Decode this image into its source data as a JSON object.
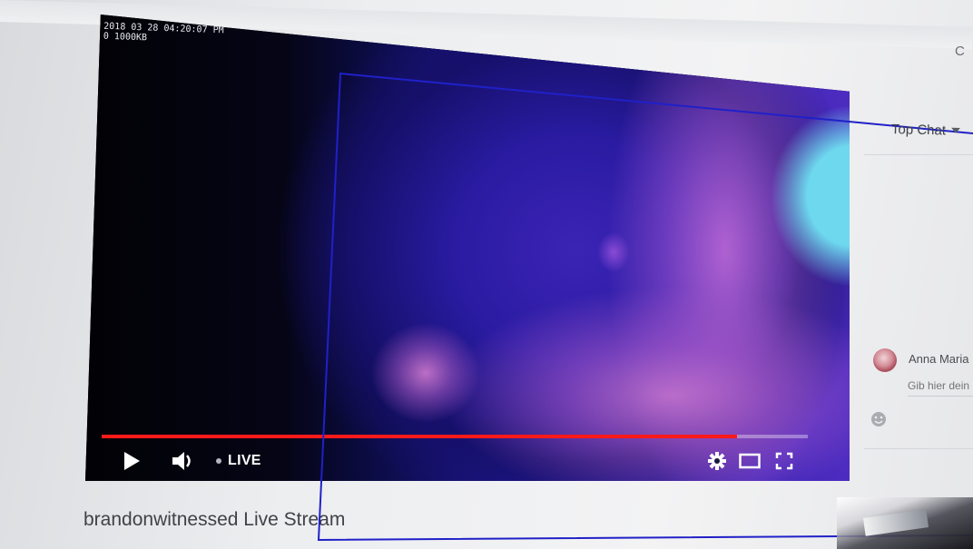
{
  "player": {
    "overlay_timestamp": "2018 03 28 04:20:07 PM\n0 1000KB",
    "progress_fraction": 0.9,
    "buffered_fraction": 1.0,
    "live_label": "LIVE",
    "colors": {
      "progress": "#ff1a1a",
      "controls": "#ffffff"
    },
    "icons": [
      "play-icon",
      "volume-icon",
      "settings-icon",
      "theater-mode-icon",
      "fullscreen-icon"
    ]
  },
  "video": {
    "title": "brandonwitnessed Live Stream"
  },
  "chat": {
    "header_label": "Top Chat",
    "author_name": "Anna Maria",
    "input_placeholder": "Gib hier dein",
    "icons": [
      "dropdown-caret-icon",
      "emoji-icon"
    ]
  },
  "header": {
    "partial_text": "C"
  }
}
